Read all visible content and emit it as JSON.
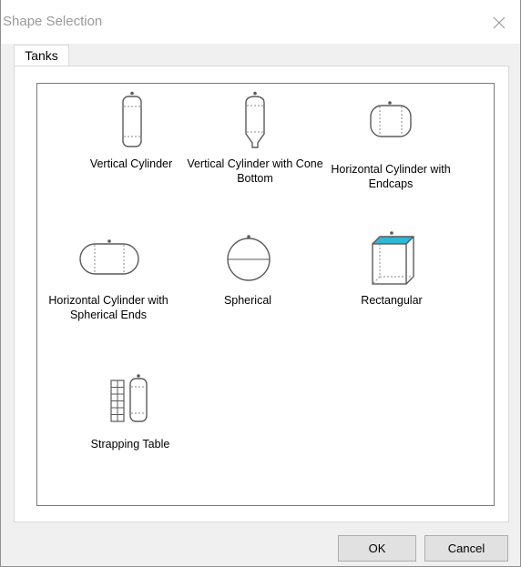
{
  "window": {
    "title": "Shape Selection"
  },
  "tabs": [
    {
      "label": "Tanks"
    }
  ],
  "shapes": [
    {
      "label": "Vertical Cylinder",
      "icon": "vertical-cylinder-icon"
    },
    {
      "label": "Vertical Cylinder with Cone Bottom",
      "icon": "vertical-cylinder-cone-bottom-icon"
    },
    {
      "label": "Horizontal Cylinder with Endcaps",
      "icon": "horizontal-cylinder-endcaps-icon"
    },
    {
      "label": "Horizontal Cylinder with Spherical Ends",
      "icon": "horizontal-cylinder-spherical-ends-icon"
    },
    {
      "label": "Spherical",
      "icon": "spherical-icon"
    },
    {
      "label": "Rectangular",
      "icon": "rectangular-icon"
    },
    {
      "label": "Strapping Table",
      "icon": "strapping-table-icon"
    }
  ],
  "buttons": {
    "ok": "OK",
    "cancel": "Cancel"
  },
  "colors": {
    "icon_stroke": "#5a5a5a",
    "accent_fill": "#2fb8d6"
  }
}
